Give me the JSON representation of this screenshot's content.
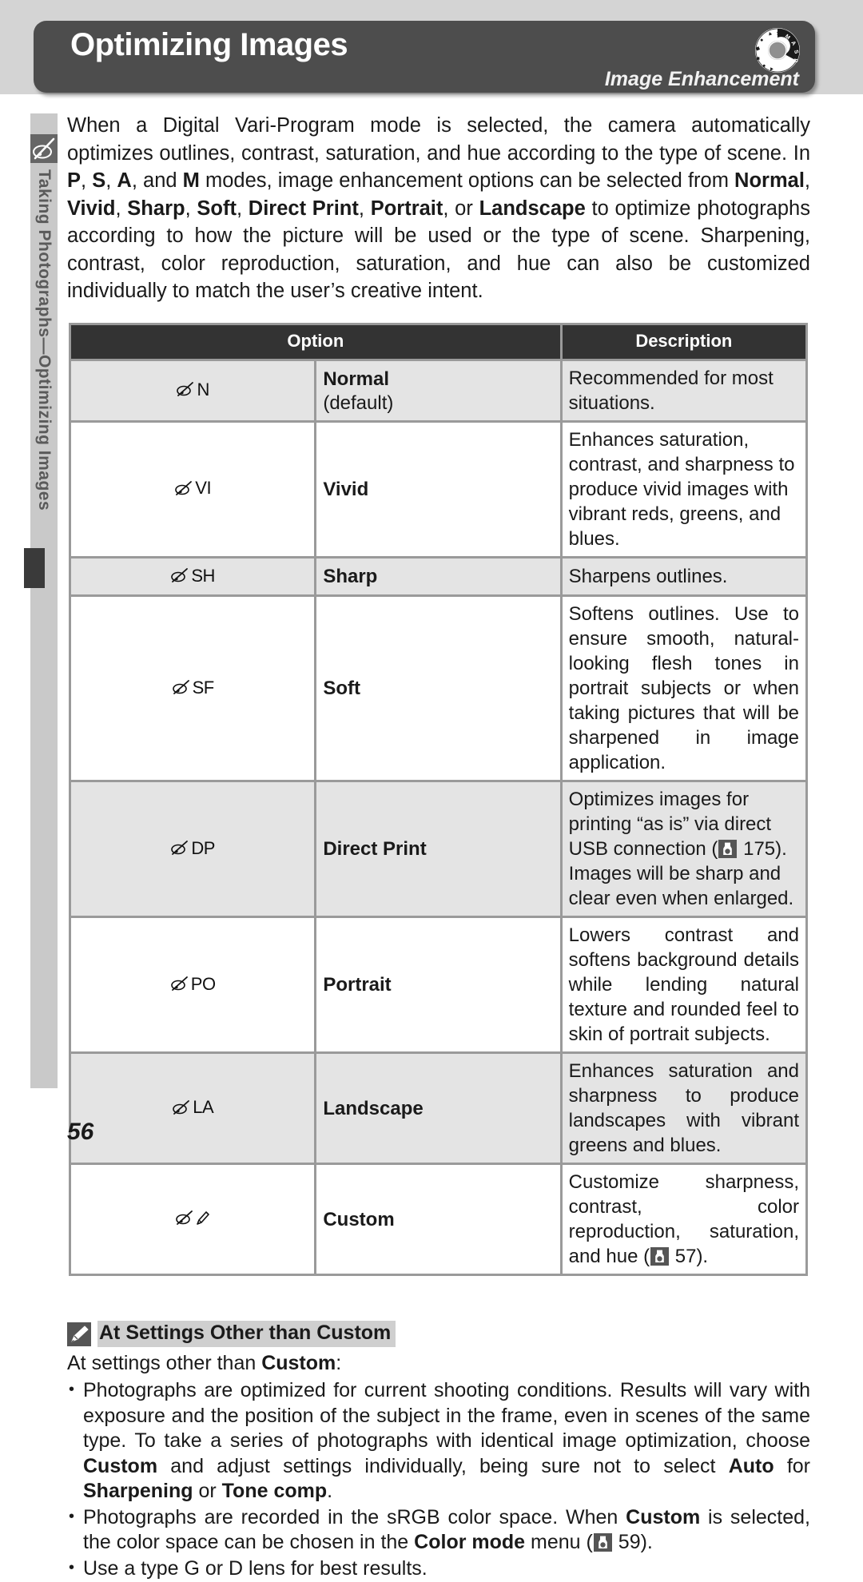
{
  "header": {
    "title": "Optimizing Images",
    "subtitle": "Image Enhancement",
    "dial_icon": "camera-mode-dial-icon"
  },
  "sidebar": {
    "icon": "image-optimize-pen-icon",
    "label": "Taking Photographs—Optimizing Images"
  },
  "intro": {
    "paragraph": "When a Digital Vari-Program mode is selected, the camera automatically optimizes outlines, contrast, saturation, and hue according to the type of scene.  In <b>P</b>, <b>S</b>, <b>A</b>, and <b>M</b> modes, image enhancement options can be selected from <b>Normal</b>, <b>Vivid</b>, <b>Sharp</b>, <b>Soft</b>, <b>Direct Print</b>, <b>Portrait</b>, or <b>Landscape</b> to optimize photographs according to how the picture will be used or the type of scene.  Sharpening, contrast, color reproduction, saturation, and hue can also be customized individually to match the user’s creative intent."
  },
  "table": {
    "headers": {
      "option": "Option",
      "description": "Description"
    },
    "rows": [
      {
        "code": "N",
        "name": "Normal",
        "sub": "(default)",
        "description": "Recommended for most situations.",
        "justify": false,
        "shaded": true
      },
      {
        "code": "VI",
        "name": "Vivid",
        "sub": "",
        "description": "Enhances saturation, contrast, and sharpness to produce vivid images with vibrant reds, greens, and blues.",
        "justify": false,
        "shaded": false
      },
      {
        "code": "SH",
        "name": "Sharp",
        "sub": "",
        "description": "Sharpens outlines.",
        "justify": false,
        "shaded": true
      },
      {
        "code": "SF",
        "name": "Soft",
        "sub": "",
        "description": "Softens outlines.  Use to ensure smooth, natural-looking flesh tones in portrait subjects or when taking pictures that will be sharpened in image application.",
        "justify": true,
        "shaded": false
      },
      {
        "code": "DP",
        "name": "Direct Print",
        "sub": "",
        "description": "Optimizes images for printing “as is” via direct USB connection (<ref>175</ref>).  Images will be sharp and clear even when enlarged.",
        "justify": false,
        "shaded": true
      },
      {
        "code": "PO",
        "name": "Portrait",
        "sub": "",
        "description": "Lowers contrast and softens background details while lending natural texture and rounded feel to skin of portrait subjects.",
        "justify": true,
        "shaded": false
      },
      {
        "code": "LA",
        "name": "Landscape",
        "sub": "",
        "description": "Enhances saturation and sharpness to produce landscapes with vibrant greens and blues.",
        "justify": true,
        "shaded": true
      },
      {
        "code": "",
        "name": "Custom",
        "sub": "",
        "description": "Customize sharpness, contrast, color reproduction, saturation, and hue (<ref>57</ref>).",
        "justify": true,
        "shaded": false
      }
    ]
  },
  "note": {
    "icon": "pencil-icon",
    "title": "At Settings Other than Custom",
    "lead": "At settings other than <b>Custom</b>:",
    "bullets": [
      "Photographs are optimized for current shooting conditions.  Results will vary with exposure and the position of the subject in the frame, even in scenes of the same type.  To take a series of photographs with identical image optimization, choose <b>Custom</b> and adjust settings individually, being sure not to select <b>Auto</b> for <b>Sharpening</b> or <b>Tone comp</b>.",
      "Photographs are recorded in the sRGB color space.  When <b>Custom</b> is selected, the color space can be chosen in the <b>Color mode</b> menu (<ref>59</ref>).",
      "Use a type G or D lens for best results."
    ]
  },
  "page_number": "56",
  "colors": {
    "header_bar": "#4d4d4d",
    "table_header": "#333333",
    "row_shade": "#e4e4e4",
    "sidebar": "#c9c9c9",
    "top_band": "#d4d4d4"
  }
}
